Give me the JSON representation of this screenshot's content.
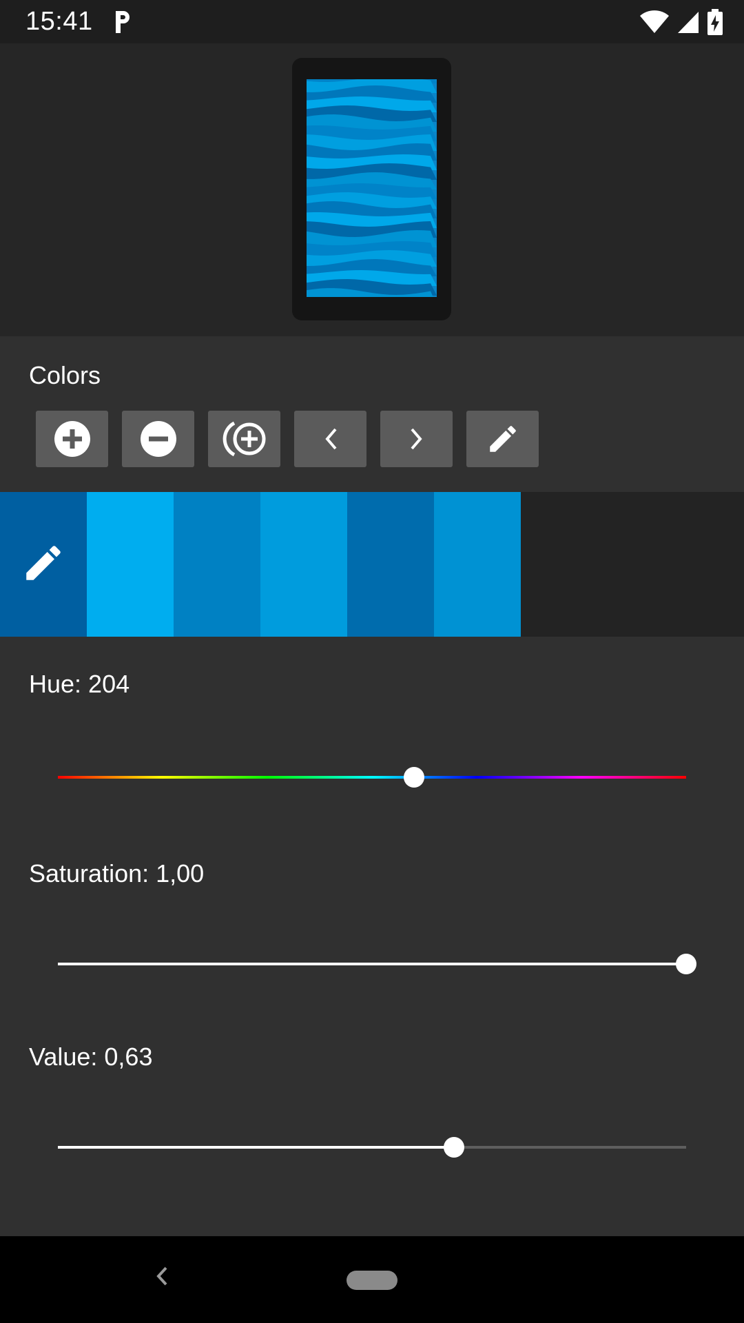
{
  "status_bar": {
    "time": "15:41",
    "app_icon": "parking-p-icon",
    "icons": [
      "wifi-icon",
      "cell-signal-icon",
      "battery-charging-icon"
    ]
  },
  "preview": {
    "stripe_colors": [
      "#0083c8",
      "#009fe0",
      "#0077bb",
      "#00a8ea",
      "#0068a8",
      "#0093d3"
    ]
  },
  "colors_section": {
    "title": "Colors",
    "toolbar": [
      {
        "icon": "add-circle-icon",
        "label": "Add color"
      },
      {
        "icon": "remove-circle-icon",
        "label": "Remove color"
      },
      {
        "icon": "add-random-icon",
        "label": "Add random color"
      },
      {
        "icon": "chevron-left-icon",
        "label": "Move left"
      },
      {
        "icon": "chevron-right-icon",
        "label": "Move right"
      },
      {
        "icon": "pencil-icon",
        "label": "Edit"
      }
    ]
  },
  "swatches": {
    "selected_index": 0,
    "colors": [
      "#005fa1",
      "#00adef",
      "#0081c3",
      "#009cdd",
      "#006cad",
      "#0092d3"
    ],
    "selected_icon": "pencil-icon"
  },
  "sliders": {
    "hue": {
      "label": "Hue: 204",
      "value": 204,
      "max": 360
    },
    "saturation": {
      "label": "Saturation: 1,00",
      "value": 1.0,
      "max": 1.0
    },
    "value": {
      "label": "Value: 0,63",
      "value": 0.63,
      "max": 1.0
    }
  },
  "nav_bar": {
    "back_icon": "nav-back-icon",
    "home_icon": "nav-home-pill"
  },
  "colors": {
    "accent_white": "#ffffff",
    "button_bg": "#5b5b5b",
    "panel_bg": "#303030"
  }
}
